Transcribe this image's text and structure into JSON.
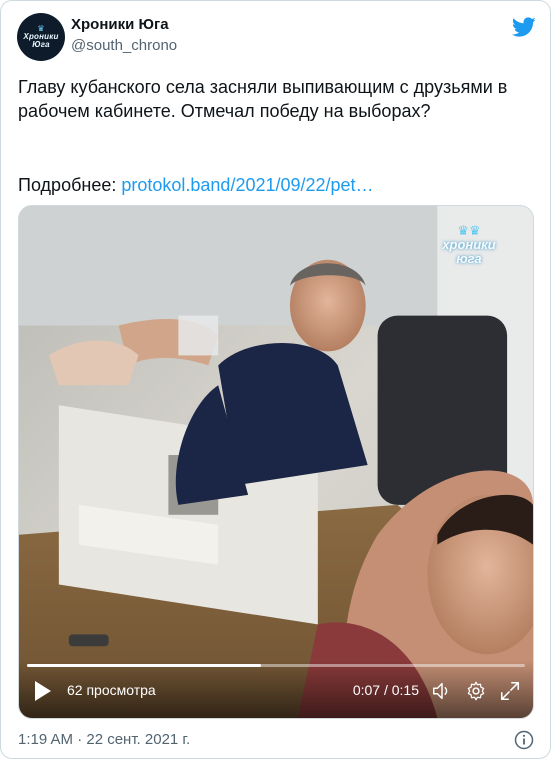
{
  "author": {
    "name": "Хроники Юга",
    "handle": "@south_chrono",
    "avatar_text_line1": "Хроники",
    "avatar_text_line2": "Юга"
  },
  "tweet": {
    "text": "Главу кубанского села засняли выпивающим с друзьями в рабочем кабинете. Отмечал победу на выборах?",
    "more_label": "Подробнее: ",
    "link_text": "protokol.band/2021/09/22/pet…"
  },
  "video": {
    "watermark_line1": "хроники",
    "watermark_line2": "юга",
    "views": "62 просмотра",
    "time": "0:07 / 0:15",
    "progress_fraction": 0.47
  },
  "footer": {
    "timestamp": "1:19 AM · 22 сент. 2021 г."
  },
  "icons": {
    "twitter": "twitter-bird-icon",
    "play": "play-icon",
    "volume": "volume-icon",
    "settings": "settings-icon",
    "fullscreen": "fullscreen-icon",
    "info": "info-icon"
  },
  "colors": {
    "brand_blue": "#1d9bf0",
    "text_primary": "#0f1419",
    "text_secondary": "#536471"
  }
}
